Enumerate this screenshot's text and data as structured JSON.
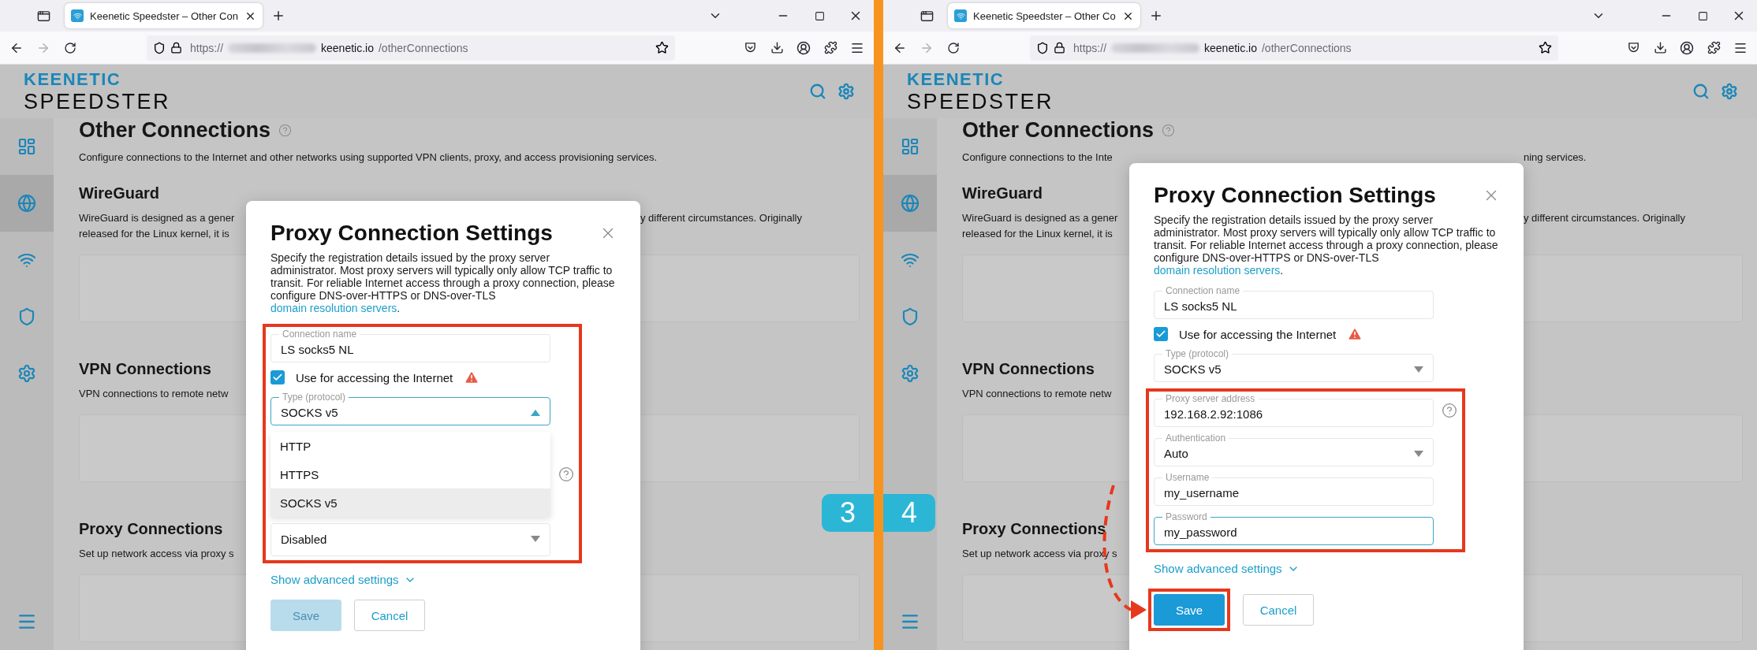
{
  "panels": [
    {
      "browser": {
        "tab_title": "Keenetic Speedster – Other Con",
        "url_scheme": "https://",
        "url_host": "keenetic.io",
        "url_path": "/otherConnections"
      },
      "logo": {
        "top": "KEENETIC",
        "bottom": "SPEEDSTER"
      },
      "sidebar": [
        {
          "kind": "dashboard",
          "selected": false
        },
        {
          "kind": "globe",
          "selected": true
        },
        {
          "kind": "wifi",
          "selected": false
        },
        {
          "kind": "shield",
          "selected": false
        },
        {
          "kind": "gear",
          "selected": false
        }
      ],
      "page": {
        "title": "Other Connections",
        "intro": {
          "left": "Configure connections to the Internet and other networks using supported VPN clients, proxy, and access provisioning services."
        },
        "sections": [
          {
            "heading": "WireGuard",
            "lines": [
              {
                "left": "WireGuard is designed as a gener",
                "right": "y different circumstances. Originally"
              },
              {
                "left": "released for the Linux kernel, it is"
              }
            ]
          },
          {
            "heading": "VPN Connections",
            "lines": [
              {
                "left": "VPN connections to remote netw"
              }
            ]
          },
          {
            "heading": "Proxy Connections",
            "lines": [
              {
                "left": "Set up network access via proxy s"
              }
            ]
          }
        ]
      },
      "dialog": {
        "title": "Proxy Connection Settings",
        "description": "Specify the registration details issued by the proxy server administrator. Most proxy servers will typically only allow TCP traffic to transit. For reliable Internet access through a proxy connection, please configure DNS-over-HTTPS or DNS-over-TLS",
        "link": "domain resolution servers",
        "description_end": ".",
        "field_groups": [
          {
            "highlighted": true,
            "fields": [
              {
                "kind": "text",
                "label": "Connection name",
                "value": "LS socks5 NL",
                "focused": false
              },
              {
                "kind": "checkbox",
                "label": "Use for accessing the Internet",
                "checked": true,
                "warning": true
              },
              {
                "kind": "select",
                "label": "Type (protocol)",
                "value": "SOCKS v5",
                "focused": true,
                "expanded": true
              },
              {
                "kind": "menu",
                "options": [
                  {
                    "label": "HTTP",
                    "selected": false
                  },
                  {
                    "label": "HTTPS",
                    "selected": false
                  },
                  {
                    "label": "SOCKS v5",
                    "selected": true
                  }
                ],
                "help": true
              },
              {
                "kind": "select",
                "value": "Disabled",
                "focused": false,
                "expanded": false
              }
            ]
          }
        ],
        "advanced": "Show advanced settings",
        "buttons": [
          {
            "kind": "primary",
            "label": "Save",
            "disabled": true
          },
          {
            "kind": "secondary",
            "label": "Cancel",
            "disabled": false
          }
        ]
      },
      "step_badge": "3"
    },
    {
      "browser": {
        "tab_title": "Keenetic Speedster – Other Co",
        "url_scheme": "https://",
        "url_host": "keenetic.io",
        "url_path": "/otherConnections"
      },
      "logo": {
        "top": "KEENETIC",
        "bottom": "SPEEDSTER"
      },
      "sidebar": [
        {
          "kind": "dashboard",
          "selected": false
        },
        {
          "kind": "globe",
          "selected": true
        },
        {
          "kind": "wifi",
          "selected": false
        },
        {
          "kind": "shield",
          "selected": false
        },
        {
          "kind": "gear",
          "selected": false
        }
      ],
      "page": {
        "title": "Other Connections",
        "intro": {
          "left": "Configure connections to the Inte",
          "right": "ning services."
        },
        "sections": [
          {
            "heading": "WireGuard",
            "lines": [
              {
                "left": "WireGuard is designed as a gener",
                "right": "y different circumstances. Originally"
              },
              {
                "left": "released for the Linux kernel, it is"
              }
            ]
          },
          {
            "heading": "VPN Connections",
            "lines": [
              {
                "left": "VPN connections to remote netw"
              }
            ]
          },
          {
            "heading": "Proxy Connections",
            "lines": [
              {
                "left": "Set up network access via proxy s"
              }
            ]
          }
        ]
      },
      "dialog": {
        "title": "Proxy Connection Settings",
        "description": "Specify the registration details issued by the proxy server administrator. Most proxy servers will typically only allow TCP traffic to transit. For reliable Internet access through a proxy connection, please configure DNS-over-HTTPS or DNS-over-TLS",
        "link": "domain resolution servers",
        "description_end": ".",
        "field_groups": [
          {
            "fields": [
              {
                "kind": "text",
                "label": "Connection name",
                "value": "LS socks5 NL",
                "focused": false
              },
              {
                "kind": "checkbox",
                "label": "Use for accessing the Internet",
                "checked": true,
                "warning": true
              },
              {
                "kind": "select",
                "label": "Type (protocol)",
                "value": "SOCKS v5",
                "focused": false,
                "expanded": false
              }
            ]
          },
          {
            "highlighted": true,
            "fields": [
              {
                "kind": "text",
                "label": "Proxy server address",
                "value": "192.168.2.92:1086",
                "focused": false,
                "help": true
              },
              {
                "kind": "select",
                "label": "Authentication",
                "value": "Auto",
                "focused": false,
                "expanded": false
              },
              {
                "kind": "text",
                "label": "Username",
                "value": "my_username",
                "focused": false
              },
              {
                "kind": "text",
                "label": "Password",
                "value": "my_password",
                "focused": true
              }
            ]
          }
        ],
        "advanced": "Show advanced settings",
        "buttons": [
          {
            "kind": "primary",
            "label": "Save",
            "disabled": false,
            "highlighted": true
          },
          {
            "kind": "secondary",
            "label": "Cancel",
            "disabled": false
          }
        ]
      },
      "step_badge": "4",
      "pointer_arrow": true
    }
  ]
}
